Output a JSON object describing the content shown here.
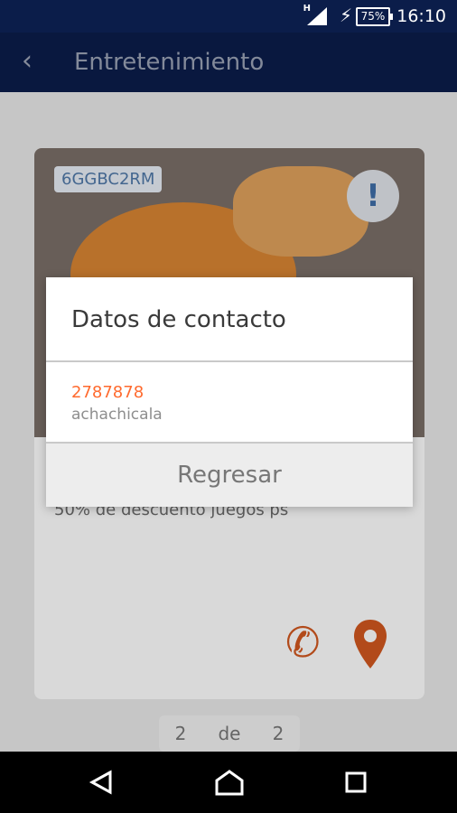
{
  "status_bar": {
    "network_type": "H",
    "battery_percent": "75%",
    "time": "16:10",
    "icons": [
      "signal-icon",
      "charging-bolt-icon",
      "battery-icon"
    ]
  },
  "app_bar": {
    "back_icon": "chevron-left-icon",
    "title": "Entretenimiento"
  },
  "card": {
    "code": "6GGBC2RM",
    "info_icon": "exclamation-icon",
    "description": "50% de descuento juegos ps",
    "actions": [
      {
        "name": "phone-icon",
        "color": "#d2581f"
      },
      {
        "name": "map-pin-icon",
        "color": "#d2581f"
      }
    ]
  },
  "pager": {
    "current": "2",
    "separator": "de",
    "total": "2"
  },
  "dialog": {
    "title": "Datos de contacto",
    "phone": "2787878",
    "contact_name": "achachicala",
    "return_label": "Regresar"
  },
  "nav_bar": {
    "back_icon": "triangle-back-icon",
    "home_icon": "home-icon",
    "recent_icon": "recent-apps-icon"
  },
  "colors": {
    "primary": "#0b1d4a",
    "accent": "#ff6a2e"
  }
}
